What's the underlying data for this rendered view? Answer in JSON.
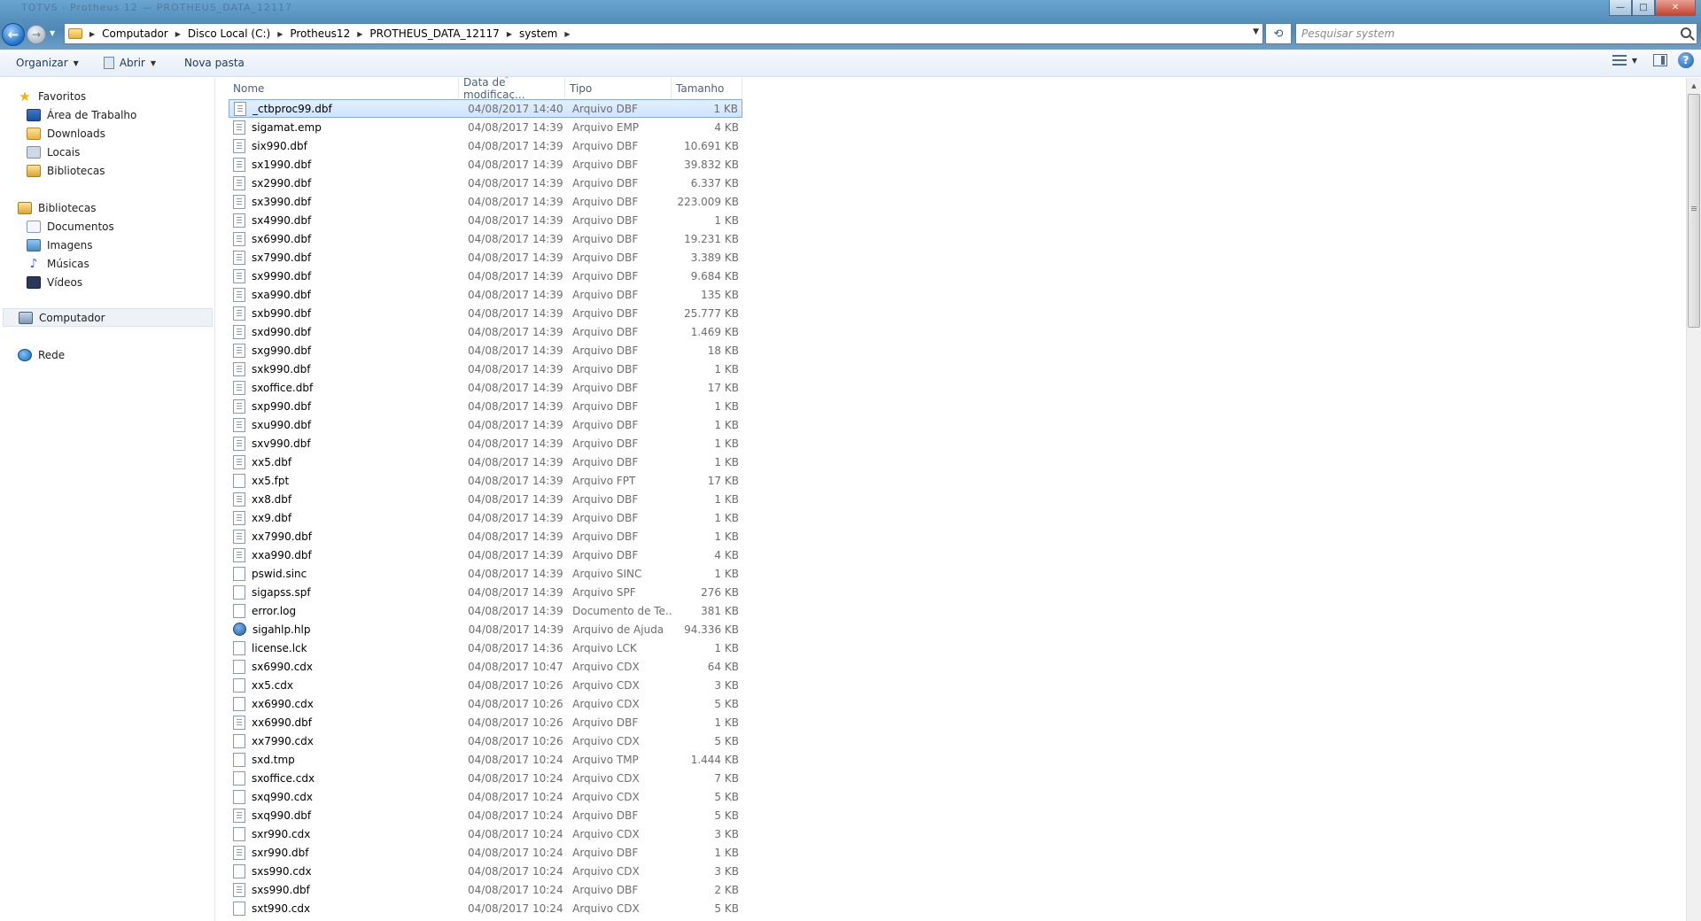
{
  "window": {
    "title_ghost": "TOTVS · Protheus 12 — PROTHEUS_DATA_12117",
    "controls": {
      "minimize": "—",
      "maximize": "□",
      "close": "✕"
    }
  },
  "address": {
    "breadcrumbs": [
      "Computador",
      "Disco Local (C:)",
      "Protheus12",
      "PROTHEUS_DATA_12117",
      "system"
    ]
  },
  "search": {
    "placeholder": "Pesquisar system"
  },
  "toolbar": {
    "organize": "Organizar",
    "open": "Abrir",
    "new_folder": "Nova pasta"
  },
  "nav": {
    "favorites": {
      "label": "Favoritos",
      "items": [
        "Área de Trabalho",
        "Downloads",
        "Locais",
        "Bibliotecas"
      ]
    },
    "libraries": {
      "label": "Bibliotecas",
      "items": [
        "Documentos",
        "Imagens",
        "Músicas",
        "Vídeos"
      ]
    },
    "computer": "Computador",
    "network": "Rede"
  },
  "columns": {
    "name": "Nome",
    "date": "Data de modificaç...",
    "type": "Tipo",
    "size": "Tamanho"
  },
  "files": [
    {
      "name": "_ctbproc99.dbf",
      "date": "04/08/2017 14:40",
      "type": "Arquivo DBF",
      "size": "1 KB",
      "icon": "dbf"
    },
    {
      "name": "sigamat.emp",
      "date": "04/08/2017 14:39",
      "type": "Arquivo EMP",
      "size": "4 KB",
      "icon": "dbf"
    },
    {
      "name": "six990.dbf",
      "date": "04/08/2017 14:39",
      "type": "Arquivo DBF",
      "size": "10.691 KB",
      "icon": "dbf"
    },
    {
      "name": "sx1990.dbf",
      "date": "04/08/2017 14:39",
      "type": "Arquivo DBF",
      "size": "39.832 KB",
      "icon": "dbf"
    },
    {
      "name": "sx2990.dbf",
      "date": "04/08/2017 14:39",
      "type": "Arquivo DBF",
      "size": "6.337 KB",
      "icon": "dbf"
    },
    {
      "name": "sx3990.dbf",
      "date": "04/08/2017 14:39",
      "type": "Arquivo DBF",
      "size": "223.009 KB",
      "icon": "dbf"
    },
    {
      "name": "sx4990.dbf",
      "date": "04/08/2017 14:39",
      "type": "Arquivo DBF",
      "size": "1 KB",
      "icon": "dbf"
    },
    {
      "name": "sx6990.dbf",
      "date": "04/08/2017 14:39",
      "type": "Arquivo DBF",
      "size": "19.231 KB",
      "icon": "dbf"
    },
    {
      "name": "sx7990.dbf",
      "date": "04/08/2017 14:39",
      "type": "Arquivo DBF",
      "size": "3.389 KB",
      "icon": "dbf"
    },
    {
      "name": "sx9990.dbf",
      "date": "04/08/2017 14:39",
      "type": "Arquivo DBF",
      "size": "9.684 KB",
      "icon": "dbf"
    },
    {
      "name": "sxa990.dbf",
      "date": "04/08/2017 14:39",
      "type": "Arquivo DBF",
      "size": "135 KB",
      "icon": "dbf"
    },
    {
      "name": "sxb990.dbf",
      "date": "04/08/2017 14:39",
      "type": "Arquivo DBF",
      "size": "25.777 KB",
      "icon": "dbf"
    },
    {
      "name": "sxd990.dbf",
      "date": "04/08/2017 14:39",
      "type": "Arquivo DBF",
      "size": "1.469 KB",
      "icon": "dbf"
    },
    {
      "name": "sxg990.dbf",
      "date": "04/08/2017 14:39",
      "type": "Arquivo DBF",
      "size": "18 KB",
      "icon": "dbf"
    },
    {
      "name": "sxk990.dbf",
      "date": "04/08/2017 14:39",
      "type": "Arquivo DBF",
      "size": "1 KB",
      "icon": "dbf"
    },
    {
      "name": "sxoffice.dbf",
      "date": "04/08/2017 14:39",
      "type": "Arquivo DBF",
      "size": "17 KB",
      "icon": "dbf"
    },
    {
      "name": "sxp990.dbf",
      "date": "04/08/2017 14:39",
      "type": "Arquivo DBF",
      "size": "1 KB",
      "icon": "dbf"
    },
    {
      "name": "sxu990.dbf",
      "date": "04/08/2017 14:39",
      "type": "Arquivo DBF",
      "size": "1 KB",
      "icon": "dbf"
    },
    {
      "name": "sxv990.dbf",
      "date": "04/08/2017 14:39",
      "type": "Arquivo DBF",
      "size": "1 KB",
      "icon": "dbf"
    },
    {
      "name": "xx5.dbf",
      "date": "04/08/2017 14:39",
      "type": "Arquivo DBF",
      "size": "1 KB",
      "icon": "dbf"
    },
    {
      "name": "xx5.fpt",
      "date": "04/08/2017 14:39",
      "type": "Arquivo FPT",
      "size": "17 KB",
      "icon": "plain"
    },
    {
      "name": "xx8.dbf",
      "date": "04/08/2017 14:39",
      "type": "Arquivo DBF",
      "size": "1 KB",
      "icon": "dbf"
    },
    {
      "name": "xx9.dbf",
      "date": "04/08/2017 14:39",
      "type": "Arquivo DBF",
      "size": "1 KB",
      "icon": "dbf"
    },
    {
      "name": "xx7990.dbf",
      "date": "04/08/2017 14:39",
      "type": "Arquivo DBF",
      "size": "1 KB",
      "icon": "dbf"
    },
    {
      "name": "xxa990.dbf",
      "date": "04/08/2017 14:39",
      "type": "Arquivo DBF",
      "size": "4 KB",
      "icon": "dbf"
    },
    {
      "name": "pswid.sinc",
      "date": "04/08/2017 14:39",
      "type": "Arquivo SINC",
      "size": "1 KB",
      "icon": "plain"
    },
    {
      "name": "sigapss.spf",
      "date": "04/08/2017 14:39",
      "type": "Arquivo SPF",
      "size": "276 KB",
      "icon": "plain"
    },
    {
      "name": "error.log",
      "date": "04/08/2017 14:39",
      "type": "Documento de Te...",
      "size": "381 KB",
      "icon": "plain"
    },
    {
      "name": "sigahlp.hlp",
      "date": "04/08/2017 14:39",
      "type": "Arquivo de Ajuda",
      "size": "94.336 KB",
      "icon": "help"
    },
    {
      "name": "license.lck",
      "date": "04/08/2017 14:36",
      "type": "Arquivo LCK",
      "size": "1 KB",
      "icon": "plain"
    },
    {
      "name": "sx6990.cdx",
      "date": "04/08/2017 10:47",
      "type": "Arquivo CDX",
      "size": "64 KB",
      "icon": "plain"
    },
    {
      "name": "xx5.cdx",
      "date": "04/08/2017 10:26",
      "type": "Arquivo CDX",
      "size": "3 KB",
      "icon": "plain"
    },
    {
      "name": "xx6990.cdx",
      "date": "04/08/2017 10:26",
      "type": "Arquivo CDX",
      "size": "5 KB",
      "icon": "plain"
    },
    {
      "name": "xx6990.dbf",
      "date": "04/08/2017 10:26",
      "type": "Arquivo DBF",
      "size": "1 KB",
      "icon": "dbf"
    },
    {
      "name": "xx7990.cdx",
      "date": "04/08/2017 10:26",
      "type": "Arquivo CDX",
      "size": "5 KB",
      "icon": "plain"
    },
    {
      "name": "sxd.tmp",
      "date": "04/08/2017 10:24",
      "type": "Arquivo TMP",
      "size": "1.444 KB",
      "icon": "plain"
    },
    {
      "name": "sxoffice.cdx",
      "date": "04/08/2017 10:24",
      "type": "Arquivo CDX",
      "size": "7 KB",
      "icon": "plain"
    },
    {
      "name": "sxq990.cdx",
      "date": "04/08/2017 10:24",
      "type": "Arquivo CDX",
      "size": "5 KB",
      "icon": "plain"
    },
    {
      "name": "sxq990.dbf",
      "date": "04/08/2017 10:24",
      "type": "Arquivo DBF",
      "size": "5 KB",
      "icon": "dbf"
    },
    {
      "name": "sxr990.cdx",
      "date": "04/08/2017 10:24",
      "type": "Arquivo CDX",
      "size": "3 KB",
      "icon": "plain"
    },
    {
      "name": "sxr990.dbf",
      "date": "04/08/2017 10:24",
      "type": "Arquivo DBF",
      "size": "1 KB",
      "icon": "dbf"
    },
    {
      "name": "sxs990.cdx",
      "date": "04/08/2017 10:24",
      "type": "Arquivo CDX",
      "size": "3 KB",
      "icon": "plain"
    },
    {
      "name": "sxs990.dbf",
      "date": "04/08/2017 10:24",
      "type": "Arquivo DBF",
      "size": "2 KB",
      "icon": "dbf"
    },
    {
      "name": "sxt990.cdx",
      "date": "04/08/2017 10:24",
      "type": "Arquivo CDX",
      "size": "5 KB",
      "icon": "plain"
    }
  ],
  "selected_index": 0
}
